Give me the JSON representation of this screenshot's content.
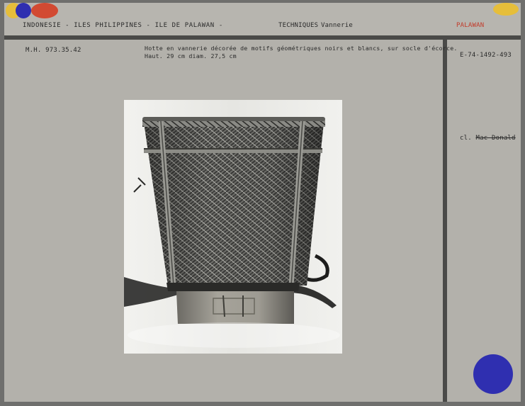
{
  "header": {
    "location": "INDONESIE - ILES PHILIPPINES - ILE DE PALAWAN -",
    "technique": "TECHNIQUES",
    "technique_value": "Vannerie",
    "region": "PALAWAN"
  },
  "record": {
    "inventory": "M.H. 973.35.42",
    "description": "Hotte en vannerie décorée de motifs géométriques noirs et blancs, sur socle d'écorce.",
    "dimensions": "Haut. 29 cm   diam. 27,5 cm",
    "ref_number": "E-74-1492-493",
    "credit_prefix": "cl.",
    "credit_name": "Mac Donald"
  },
  "colors": {
    "dot_yellow": "#e6be3a",
    "dot_blue": "#2f2fb0",
    "dot_red": "#d24a32",
    "region_text": "#c23a2a"
  }
}
